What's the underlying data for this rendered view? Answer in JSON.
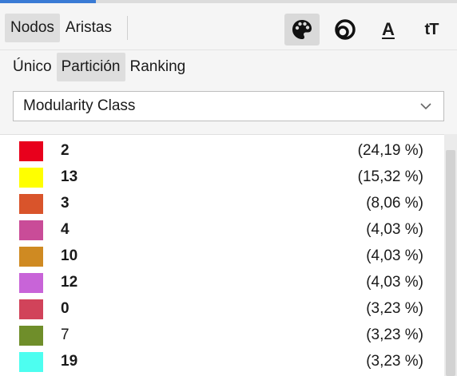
{
  "colors": {
    "accent": "#3a7bd5",
    "tab_selected_bg": "#dedede"
  },
  "element_tabs": [
    {
      "label": "Nodos",
      "selected": true
    },
    {
      "label": "Aristas",
      "selected": false
    }
  ],
  "property_icons": [
    {
      "name": "palette-icon",
      "active": true
    },
    {
      "name": "size-icon",
      "active": false
    },
    {
      "name": "label-color-icon",
      "glyph": "A",
      "active": false
    },
    {
      "name": "label-size-icon",
      "glyph": "tT",
      "active": false
    }
  ],
  "mode_tabs": [
    {
      "label": "Único",
      "selected": false
    },
    {
      "label": "Partición",
      "selected": true
    },
    {
      "label": "Ranking",
      "selected": false
    }
  ],
  "attribute_dropdown": {
    "value": "Modularity Class"
  },
  "partitions": [
    {
      "label": "2",
      "percent": "(24,19 %)",
      "color": "#e8001c"
    },
    {
      "label": "13",
      "percent": "(15,32 %)",
      "color": "#ffff00"
    },
    {
      "label": "3",
      "percent": "(8,06 %)",
      "color": "#d9542b"
    },
    {
      "label": "4",
      "percent": "(4,03 %)",
      "color": "#c94c98"
    },
    {
      "label": "10",
      "percent": "(4,03 %)",
      "color": "#cf8a22"
    },
    {
      "label": "12",
      "percent": "(4,03 %)",
      "color": "#c864d8"
    },
    {
      "label": "0",
      "percent": "(3,23 %)",
      "color": "#d1435a"
    },
    {
      "label": "7",
      "percent": "(3,23 %)",
      "color": "#6f8e2a"
    },
    {
      "label": "19",
      "percent": "(3,23 %)",
      "color": "#4dfef0"
    }
  ]
}
